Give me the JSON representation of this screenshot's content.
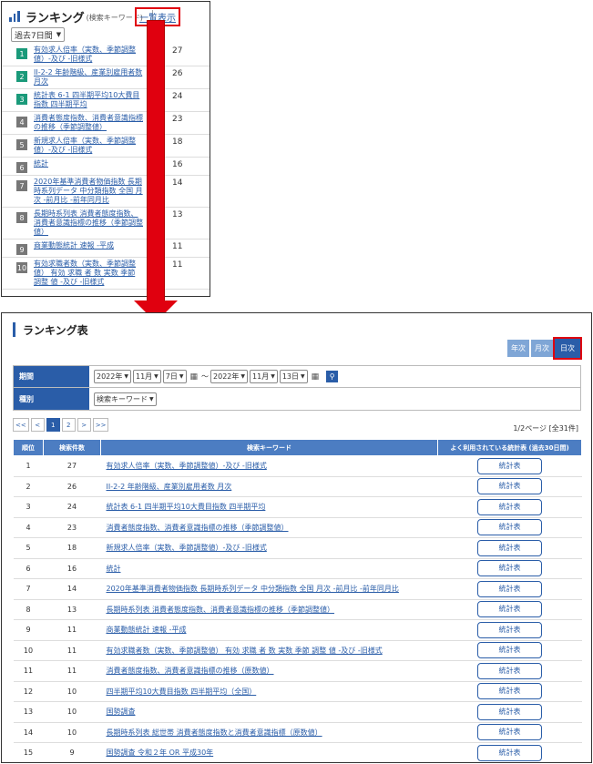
{
  "top_panel": {
    "title": "ランキング",
    "subtitle": "(検索キーワード)",
    "list_link": "一覧表示",
    "period_select": "過去7日間",
    "items": [
      {
        "rank": "1",
        "text": "有効求人倍率（実数、季節調整値）-及び -旧様式",
        "count": "27",
        "color": "#1a9a7a"
      },
      {
        "rank": "2",
        "text": "II-2-2 年齢階級、産業別雇用者数 月次",
        "count": "26",
        "color": "#1a9a7a"
      },
      {
        "rank": "3",
        "text": "統計表 6-1 四半期平均10大費目指数 四半期平均",
        "count": "24",
        "color": "#1a9a7a"
      },
      {
        "rank": "4",
        "text": "消費者態度指数、消費者意識指標の推移（季節調整値）",
        "count": "23",
        "color": "#777777"
      },
      {
        "rank": "5",
        "text": "新規求人倍率（実数、季節調整値）-及び -旧様式",
        "count": "18",
        "color": "#777777"
      },
      {
        "rank": "6",
        "text": "統計",
        "count": "16",
        "color": "#777777"
      },
      {
        "rank": "7",
        "text": "2020年基準消費者物価指数 長期時系列データ 中分類指数 全国 月次 -前月比 -前年同月比",
        "count": "14",
        "color": "#777777"
      },
      {
        "rank": "8",
        "text": "長期時系列表 消費者態度指数、消費者意識指標の推移（季節調整値）",
        "count": "13",
        "color": "#777777"
      },
      {
        "rank": "9",
        "text": "商業動態統計 速報 -平成",
        "count": "11",
        "color": "#777777"
      },
      {
        "rank": "10",
        "text": "有効求職者数（実数、季節調整値） 有効 求職 者 数 実数 季節 調整 値 -及び -旧様式",
        "count": "11",
        "color": "#777777"
      }
    ]
  },
  "bottom_panel": {
    "title": "ランキング表",
    "period_buttons": [
      "年次",
      "月次",
      "日次"
    ],
    "filter": {
      "period_label": "期間",
      "type_label": "種別",
      "from_year": "2022年",
      "from_month": "11月",
      "from_day": "7日",
      "tilde": "～",
      "to_year": "2022年",
      "to_month": "11月",
      "to_day": "13日",
      "type_value": "検索キーワード",
      "calendar_icon": "calendar-icon",
      "search_icon": "search-icon"
    },
    "pager": [
      "<<",
      "<",
      "1",
      "2",
      ">",
      ">>"
    ],
    "page_info": "1/2ページ [全31件]",
    "columns": [
      "順位",
      "検索件数",
      "検索キーワード",
      "よく利用されている統計表 (過去30日間)"
    ],
    "stat_button_label": "統計表",
    "rows": [
      {
        "rank": "1",
        "count": "27",
        "keyword": "有効求人倍率（実数、季節調整値）-及び -旧様式"
      },
      {
        "rank": "2",
        "count": "26",
        "keyword": "II-2-2 年齢階級、産業別雇用者数 月次"
      },
      {
        "rank": "3",
        "count": "24",
        "keyword": "統計表 6-1 四半期平均10大費目指数 四半期平均"
      },
      {
        "rank": "4",
        "count": "23",
        "keyword": "消費者態度指数、消費者意識指標の推移（季節調整値）"
      },
      {
        "rank": "5",
        "count": "18",
        "keyword": "新規求人倍率（実数、季節調整値）-及び -旧様式"
      },
      {
        "rank": "6",
        "count": "16",
        "keyword": "統計"
      },
      {
        "rank": "7",
        "count": "14",
        "keyword": "2020年基準消費者物価指数 長期時系列データ 中分類指数 全国 月次 -前月比 -前年同月比"
      },
      {
        "rank": "8",
        "count": "13",
        "keyword": "長期時系列表 消費者態度指数、消費者意識指標の推移（季節調整値）"
      },
      {
        "rank": "9",
        "count": "11",
        "keyword": "商業動態統計 速報 -平成"
      },
      {
        "rank": "10",
        "count": "11",
        "keyword": "有効求職者数（実数、季節調整値） 有効 求職 者 数 実数 季節 調整 値 -及び -旧様式"
      },
      {
        "rank": "11",
        "count": "11",
        "keyword": "消費者態度指数、消費者意識指標の推移（原数値）"
      },
      {
        "rank": "12",
        "count": "10",
        "keyword": "四半期平均10大費目指数 四半期平均（全国）"
      },
      {
        "rank": "13",
        "count": "10",
        "keyword": "国勢調査"
      },
      {
        "rank": "14",
        "count": "10",
        "keyword": "長期時系列表 総世帯 消費者態度指数と消費者意識指標（原数値）"
      },
      {
        "rank": "15",
        "count": "9",
        "keyword": "国勢調査 令和２年 OR 平成30年"
      }
    ]
  }
}
